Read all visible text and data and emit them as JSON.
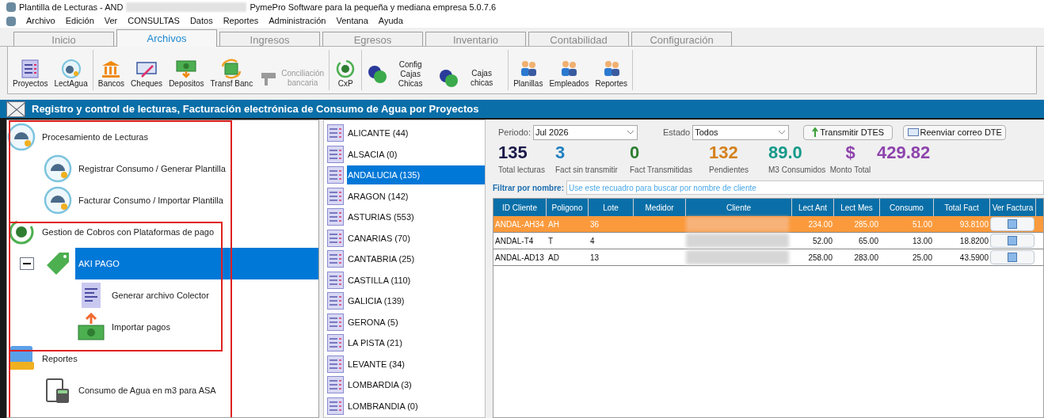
{
  "window": {
    "title_start": "Plantilla de Lecturas - AND",
    "title_end": "PymePro Software para la pequeña y mediana empresa 5.0.7.6"
  },
  "menu": [
    "Archivo",
    "Edición",
    "Ver",
    "CONSULTAS",
    "Datos",
    "Reportes",
    "Administración",
    "Ventana",
    "Ayuda"
  ],
  "tabs": [
    {
      "label": "Inicio",
      "selected": false
    },
    {
      "label": "Archivos",
      "selected": true
    },
    {
      "label": "Ingresos",
      "selected": false
    },
    {
      "label": "Egresos",
      "selected": false
    },
    {
      "label": "Inventario",
      "selected": false
    },
    {
      "label": "Contabilidad",
      "selected": false
    },
    {
      "label": "Configuración",
      "selected": false
    }
  ],
  "ribbon": [
    [
      {
        "label": "Proyectos",
        "disabled": false
      },
      {
        "label": "LectAgua",
        "disabled": false
      }
    ],
    [
      {
        "label": "Bancos",
        "disabled": false
      },
      {
        "label": "Cheques",
        "disabled": false
      },
      {
        "label": "Depositos",
        "disabled": false
      },
      {
        "label": "Transf Banc",
        "disabled": false
      },
      {
        "label": "Conciliación bancaria",
        "disabled": true
      }
    ],
    [
      {
        "label": "CxP",
        "disabled": false
      }
    ],
    [
      {
        "label": "Config Cajas Chicas",
        "disabled": false
      },
      {
        "label": "Cajas chicas",
        "disabled": false
      }
    ],
    [
      {
        "label": "Planillas",
        "disabled": false
      },
      {
        "label": "Empleados",
        "disabled": false
      },
      {
        "label": "Reportes",
        "disabled": false
      }
    ]
  ],
  "banner": "Registro y control de lecturas, Facturación electrónica de Consumo de Agua por Proyectos",
  "tree": [
    {
      "label": "Procesamiento de Lecturas",
      "expanded": true,
      "selected": false,
      "children": [
        {
          "label": "Registrar Consumo / Generar Plantilla",
          "selected": false
        },
        {
          "label": "Facturar Consumo / Importar Plantilla",
          "selected": false
        }
      ]
    },
    {
      "label": "Gestion de Cobros con Plataformas de pago",
      "expanded": true,
      "selected": false,
      "children": [
        {
          "label": "AKI PAGO",
          "expanded": true,
          "selected": true,
          "children": [
            {
              "label": "Generar archivo Colector",
              "selected": false
            },
            {
              "label": "Importar pagos",
              "selected": false
            }
          ]
        }
      ]
    },
    {
      "label": "Reportes",
      "expanded": true,
      "selected": false,
      "children": [
        {
          "label": "Consumo de Agua en m3 para ASA",
          "selected": false
        }
      ]
    }
  ],
  "projects": [
    {
      "label": "ALICANTE (44)",
      "selected": false
    },
    {
      "label": "ALSACIA (0)",
      "selected": false
    },
    {
      "label": "ANDALUCIA (135)",
      "selected": true
    },
    {
      "label": "ARAGON (142)",
      "selected": false
    },
    {
      "label": "ASTURIAS (553)",
      "selected": false
    },
    {
      "label": "CANARIAS (70)",
      "selected": false
    },
    {
      "label": "CANTABRIA (25)",
      "selected": false
    },
    {
      "label": "CASTILLA (110)",
      "selected": false
    },
    {
      "label": "GALICIA (139)",
      "selected": false
    },
    {
      "label": "GERONA (5)",
      "selected": false
    },
    {
      "label": "LA PISTA (21)",
      "selected": false
    },
    {
      "label": "LEVANTE (34)",
      "selected": false
    },
    {
      "label": "LOMBARDIA (3)",
      "selected": false
    },
    {
      "label": "LOMBRANDIA (0)",
      "selected": false
    }
  ],
  "filters": {
    "period_label": "Periodo:",
    "period_value": "Jul 2026",
    "status_label": "Estado",
    "status_value": "Todos",
    "buttons": [
      "Transmitir DTES",
      "Reenviar correo DTE"
    ]
  },
  "stats": [
    {
      "value": "135",
      "label": "Total lecturas",
      "color": "#1a1a4a"
    },
    {
      "value": "3",
      "label": "Fact sin transmitir",
      "color": "#1f7fc0"
    },
    {
      "value": "0",
      "label": "Fact Transmitidas",
      "color": "#2e7d32"
    },
    {
      "value": "132",
      "label": "Pendientes",
      "color": "#d4811c"
    },
    {
      "value": "89.0",
      "label": "M3 Consumidos",
      "color": "#16998a"
    },
    {
      "value": "$",
      "label": "Monto Total",
      "color": "#8e44ad"
    },
    {
      "value": "429.82",
      "color": "#8e44ad"
    }
  ],
  "search": {
    "label": "Filtrar por nombre:",
    "placeholder": "Use este recuadro para buscar por nombre de cliente"
  },
  "table": {
    "columns": [
      "ID Cliente",
      "Poligono",
      "Lote",
      "Medidor",
      "Cliente",
      "Lect Ant",
      "Lect Mes",
      "Consumo",
      "Total Fact",
      "Ver Factura"
    ],
    "rows": [
      {
        "selected": true,
        "cells": [
          "ANDAL-AH34",
          "AH",
          "36",
          null,
          null,
          "234.00",
          "285.00",
          "51.00",
          "93.8100"
        ]
      },
      {
        "selected": false,
        "cells": [
          "ANDAL-T4",
          "T",
          "4",
          null,
          null,
          "52.00",
          "65.00",
          "13.00",
          "18.8200"
        ]
      },
      {
        "selected": false,
        "cells": [
          "ANDAL-AD13",
          "AD",
          "13",
          null,
          null,
          "258.00",
          "283.00",
          "25.00",
          "43.5900"
        ]
      }
    ]
  }
}
